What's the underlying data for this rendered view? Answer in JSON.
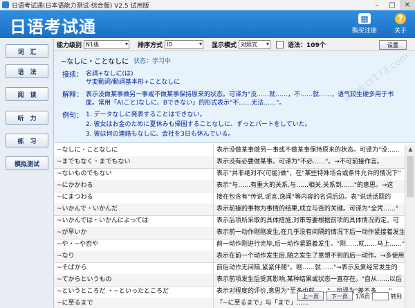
{
  "window": {
    "title": "日语考试通(日本语能力测试-综合版) V2.5 试用版"
  },
  "header": {
    "app_title": "日语考试通",
    "buy_label": "购买注册",
    "about_label": "关于"
  },
  "sidebar": {
    "items": [
      "词　汇",
      "语　法",
      "阅　读",
      "听　力",
      "练　习",
      "模拟测试"
    ]
  },
  "toolbar": {
    "level_label": "能力级别",
    "level_value": "N1级",
    "sort_label": "排序方式",
    "sort_value": "ID",
    "display_label": "显示模式",
    "display_value": "对照式",
    "grammar_count": "语法：109个",
    "settings_label": "设置"
  },
  "detail": {
    "title": "~なしに・ことなしに",
    "status": "状态：学习中",
    "connect_label": "接续：",
    "connect_lines": [
      "名詞+なしに(は)",
      "サ変動詞/動詞基本形+ことなしに"
    ],
    "explain_label": "解释：",
    "explain_lines": [
      "表示没做某事做另一事或不做某事保持原来的状态。可译为\"没……就……，不……就……，语气较生硬多用于书",
      "面。常用「A(こと)なしに、Bできない」的形式表示\"不……无法……\"。"
    ],
    "example_label": "例句：",
    "examples": [
      "1. データなしに発表することはできない。",
      "2. 彼女はお金のために夏休みも帰国することなしに、ずっとパートをしていた。",
      "3. 彼は何の連絡もなしに、会社を3日も休んでいる。"
    ],
    "watermark": "www.cr173.com"
  },
  "list": {
    "rows": [
      {
        "jp": "~なしに・ことなしに",
        "cn": "表示没做某事做另一事或不做某事保持原来的状态。可译为\"没……"
      },
      {
        "jp": "~までもなく・までもない",
        "cn": "表示没有必要做某事。可译为\"不必……\"。→不可前接作言。"
      },
      {
        "jp": "~ないものでもない",
        "cn": "表示\"并非绝对不(可能)做\"，在\"某些特殊场合或条件允许的情况下\""
      },
      {
        "jp": "~にかかわる",
        "cn": "表示\"与……有重大的关系,与……相关,关系到……\"的意思。→这"
      },
      {
        "jp": "~にまつわる",
        "cn": "接在包含有\"传说,谣言,逸闻\"等内容的名词后边。表\"说话话题的"
      },
      {
        "jp": "~いかんで・いかんだ",
        "cn": "表示前接的事物为事情的结果,成立与否的关键。可译为\"全凭……\""
      },
      {
        "jp": "~いかんでは・いかんによっては",
        "cn": "表示后项所采取的具体措施,对策等要根据前项的具体情况而定。可"
      },
      {
        "jp": "~が早いか",
        "cn": "表示前一动作刚刚发生,在几乎没有间隔的情况下后一动作紧接着发生"
      },
      {
        "jp": "~や・~や否や",
        "cn": "前一动作刚进行完毕,后一动作紧跟着发生。\"刚……就……马上……\""
      },
      {
        "jp": "~なり",
        "cn": "表示在前一个动作发生后,随之发生了意想不到的后一动作。→多使用"
      },
      {
        "jp": "~そばから",
        "cn": "前后动作无间隔,紧紧伴随\"。刚……就……\"→表示反复经常发生的"
      },
      {
        "jp": "~てからというもの",
        "cn": "表示前项发生后受其影响,某种结果或状态一直存在。\"自从……以后"
      },
      {
        "jp": "~というところだ ・~といったところだ",
        "cn": "表示对程度的评价,意思为\"至多也就……\"，可译为\"差不多……\""
      },
      {
        "jp": "~に至るまで",
        "cn": "「~に至るまで」与「まで」……"
      }
    ]
  },
  "pager": {
    "prev": "上一页",
    "next": "下一页",
    "page": "1/6页",
    "jump": "转到"
  }
}
